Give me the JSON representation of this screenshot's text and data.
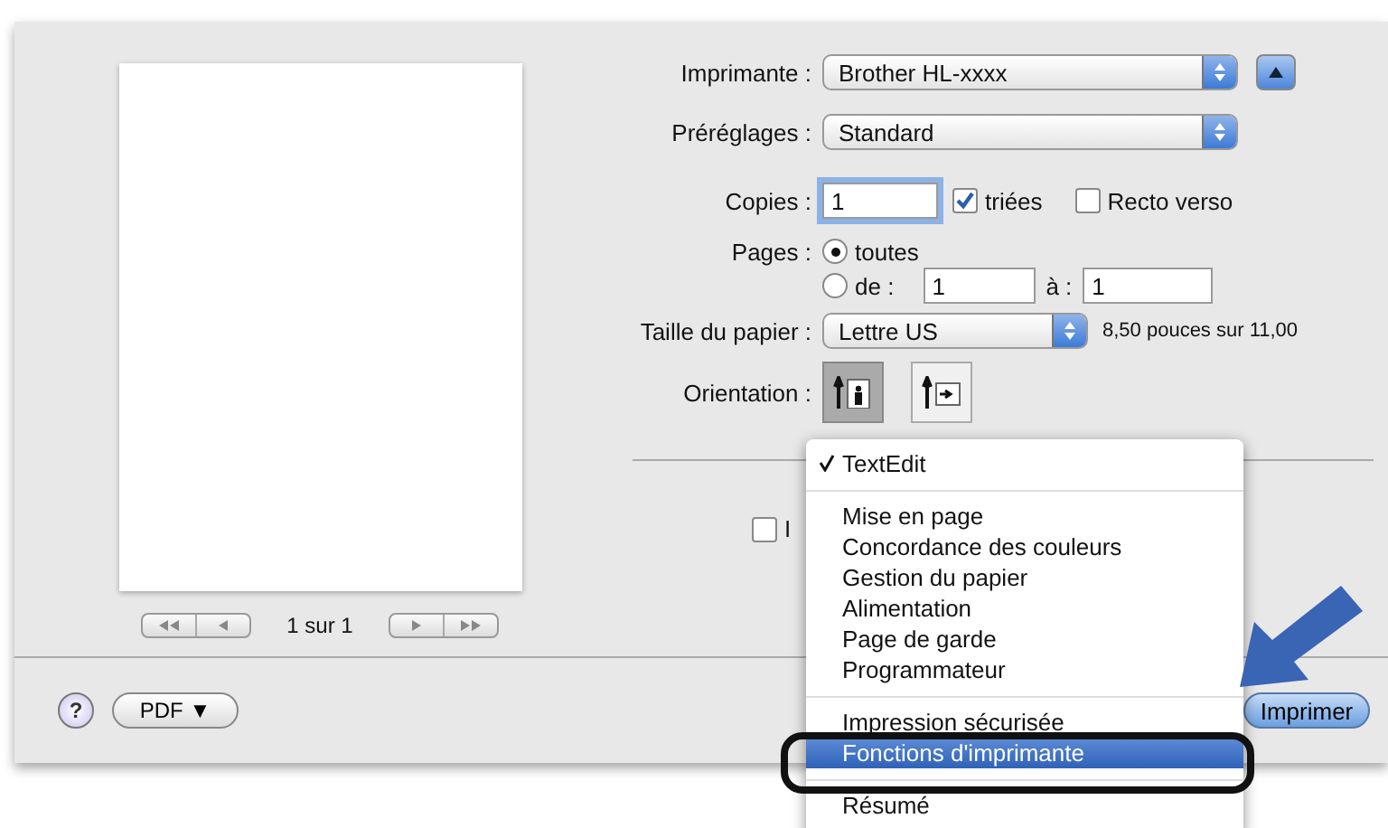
{
  "preview": {
    "page_counter": "1 sur 1"
  },
  "printer": {
    "label": "Imprimante :",
    "value": "Brother HL-xxxx"
  },
  "presets": {
    "label": "Préréglages :",
    "value": "Standard"
  },
  "copies": {
    "label": "Copies :",
    "value": "1",
    "options": [
      {
        "label": "triées",
        "checked": true
      },
      {
        "label": "Recto verso",
        "checked": false
      }
    ]
  },
  "pages": {
    "label": "Pages :",
    "options": [
      {
        "label": "toutes",
        "selected": true
      },
      {
        "label": "de :",
        "selected": false
      }
    ],
    "from": "1",
    "to_label": "à :",
    "to": "1"
  },
  "paper_size": {
    "label": "Taille du papier :",
    "value": "Lettre US",
    "dimensions": "8,50 pouces sur 11,00"
  },
  "orientation": {
    "label": "Orientation :",
    "options": [
      {
        "kind": "portrait",
        "selected": true
      },
      {
        "kind": "landscape",
        "selected": false
      }
    ]
  },
  "header_footer": {
    "label": "I",
    "checked": false
  },
  "footer": {
    "help": "?",
    "pdf_button": "PDF ▼",
    "print_button": "Imprimer"
  },
  "menu": {
    "items": [
      {
        "kind": "item",
        "label": "TextEdit",
        "checked": true,
        "selected": false
      },
      {
        "kind": "separator"
      },
      {
        "kind": "item",
        "label": "Mise en page",
        "checked": false,
        "selected": false
      },
      {
        "kind": "item",
        "label": "Concordance des couleurs",
        "checked": false,
        "selected": false
      },
      {
        "kind": "item",
        "label": "Gestion du papier",
        "checked": false,
        "selected": false
      },
      {
        "kind": "item",
        "label": "Alimentation",
        "checked": false,
        "selected": false
      },
      {
        "kind": "item",
        "label": "Page de garde",
        "checked": false,
        "selected": false
      },
      {
        "kind": "item",
        "label": "Programmateur",
        "checked": false,
        "selected": false
      },
      {
        "kind": "separator"
      },
      {
        "kind": "item",
        "label": "Impression sécurisée",
        "checked": false,
        "selected": false
      },
      {
        "kind": "item",
        "label": "Fonctions d'imprimante",
        "checked": false,
        "selected": true
      },
      {
        "kind": "separator"
      },
      {
        "kind": "item",
        "label": "Résumé",
        "checked": false,
        "selected": false
      }
    ]
  }
}
